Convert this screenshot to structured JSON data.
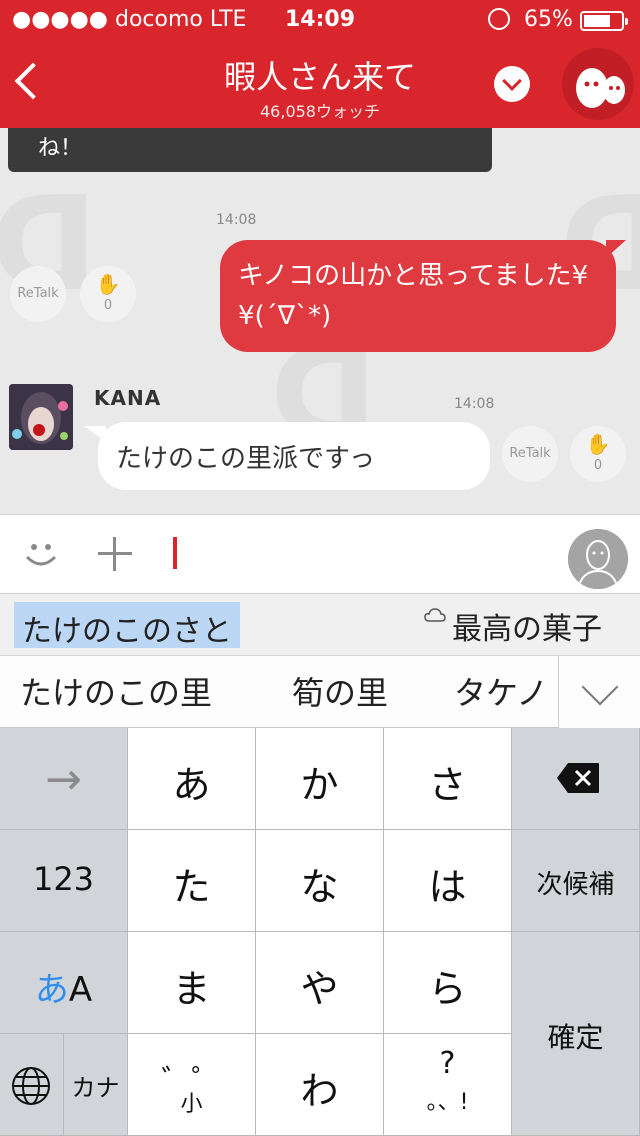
{
  "status": {
    "carrier": "●●●●● docomo  LTE",
    "time": "14:09",
    "battery": "65%"
  },
  "nav": {
    "title": "暇人さん来て",
    "subtitle": "46,058ウォッチ"
  },
  "chat": {
    "prev_text": "ね！",
    "messages": [
      {
        "time": "14:08",
        "text": "キノコの山かと思ってました¥¥(´∇`*)",
        "retalk": "ReTalk",
        "claps": "0"
      },
      {
        "time": "14:08",
        "user": "KANA",
        "text": "たけのこの里派ですっ",
        "retalk": "ReTalk",
        "claps": "0"
      }
    ]
  },
  "input": {
    "value": ""
  },
  "prediction": {
    "reading": "たけのこのさと",
    "cloud_candidate": "最高の菓子",
    "candidates": [
      "たけのこの里",
      "筍の里",
      "タケノ"
    ]
  },
  "keyboard": {
    "arrow": "→",
    "k_a": "あ",
    "k_ka": "か",
    "k_sa": "さ",
    "num": "123",
    "k_ta": "た",
    "k_na": "な",
    "k_ha": "は",
    "next": "次候補",
    "mode_a": "あ",
    "mode_A": "A",
    "k_ma": "ま",
    "k_ya": "や",
    "k_ra": "ら",
    "confirm": "確定",
    "kana": "カナ",
    "dakuten": "゛゜",
    "small": "小",
    "k_wa": "わ",
    "q": "?",
    "punct": "。、!"
  },
  "colors": {
    "brand": "#d9262c",
    "bubble_me": "#df3a3f"
  }
}
